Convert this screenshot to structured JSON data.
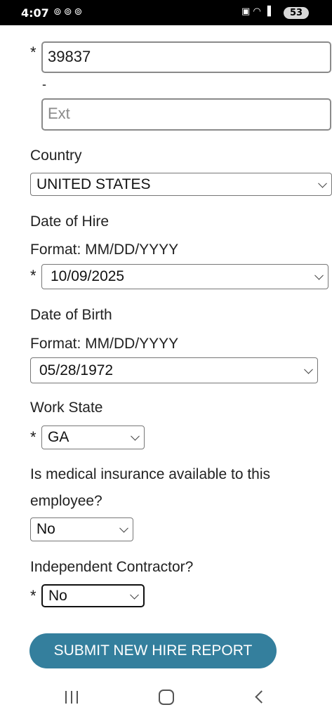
{
  "status_bar": {
    "time": "4:07",
    "notification_icons": [
      "threads-icon",
      "threads-icon",
      "threads-icon"
    ],
    "system_icons": [
      "photo-icon",
      "wifi-icon",
      "signal-icon"
    ],
    "battery": "53"
  },
  "phone": {
    "required_marker": "*",
    "number_value": "39837",
    "separator": "-",
    "ext_placeholder": "Ext"
  },
  "country": {
    "label": "Country",
    "selected": "UNITED STATES"
  },
  "hire_date": {
    "label": "Date of Hire",
    "format": "Format: MM/DD/YYYY",
    "required_marker": "*",
    "value": "10/09/2025"
  },
  "birth_date": {
    "label": "Date of Birth",
    "format": "Format: MM/DD/YYYY",
    "value": "05/28/1972"
  },
  "work_state": {
    "label": "Work State",
    "required_marker": "*",
    "selected": "GA"
  },
  "medical_insurance": {
    "label_line1": "Is medical insurance available to this",
    "label_line2": "employee?",
    "selected": "No"
  },
  "contractor": {
    "label": "Independent Contractor?",
    "required_marker": "*",
    "selected": "No"
  },
  "submit_label": "SUBMIT NEW HIRE REPORT",
  "colors": {
    "submit_bg": "#347f9d",
    "status_bar_bg": "#000000"
  }
}
